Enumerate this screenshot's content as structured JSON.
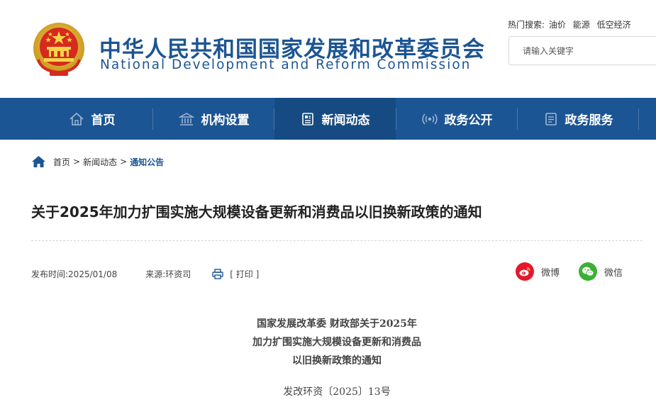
{
  "header": {
    "title_cn": "中华人民共和国国家发展和改革委员会",
    "title_en": "National Development and Reform Commission",
    "hot_search_label": "热门搜索:",
    "hot_search_terms": [
      "油价",
      "能源",
      "低空经济"
    ],
    "search_placeholder": "请输入关键字",
    "brand_color": "#1c5593"
  },
  "nav": {
    "items": [
      {
        "label": "首页",
        "icon": "home-icon"
      },
      {
        "label": "机构设置",
        "icon": "building-icon"
      },
      {
        "label": "新闻动态",
        "icon": "news-icon",
        "active": true
      },
      {
        "label": "政务公开",
        "icon": "broadcast-icon"
      },
      {
        "label": "政务服务",
        "icon": "service-icon"
      }
    ]
  },
  "breadcrumb": {
    "items": [
      "首页",
      "新闻动态"
    ],
    "separator": ">",
    "current": "通知公告"
  },
  "article": {
    "title": "关于2025年加力扩围实施大规模设备更新和消费品以旧换新政策的通知",
    "date": "发布时间:2025/01/08",
    "source": "来源:环资司",
    "print_label": "[ 打印 ]",
    "heading_lines": [
      "国家发展改革委 财政部关于2025年",
      "加力扩围实施大规模设备更新和消费品",
      "以旧换新政策的通知"
    ],
    "doc_number": "发改环资〔2025〕13号"
  },
  "share": {
    "weibo_label": "微博",
    "wechat_label": "微信"
  }
}
